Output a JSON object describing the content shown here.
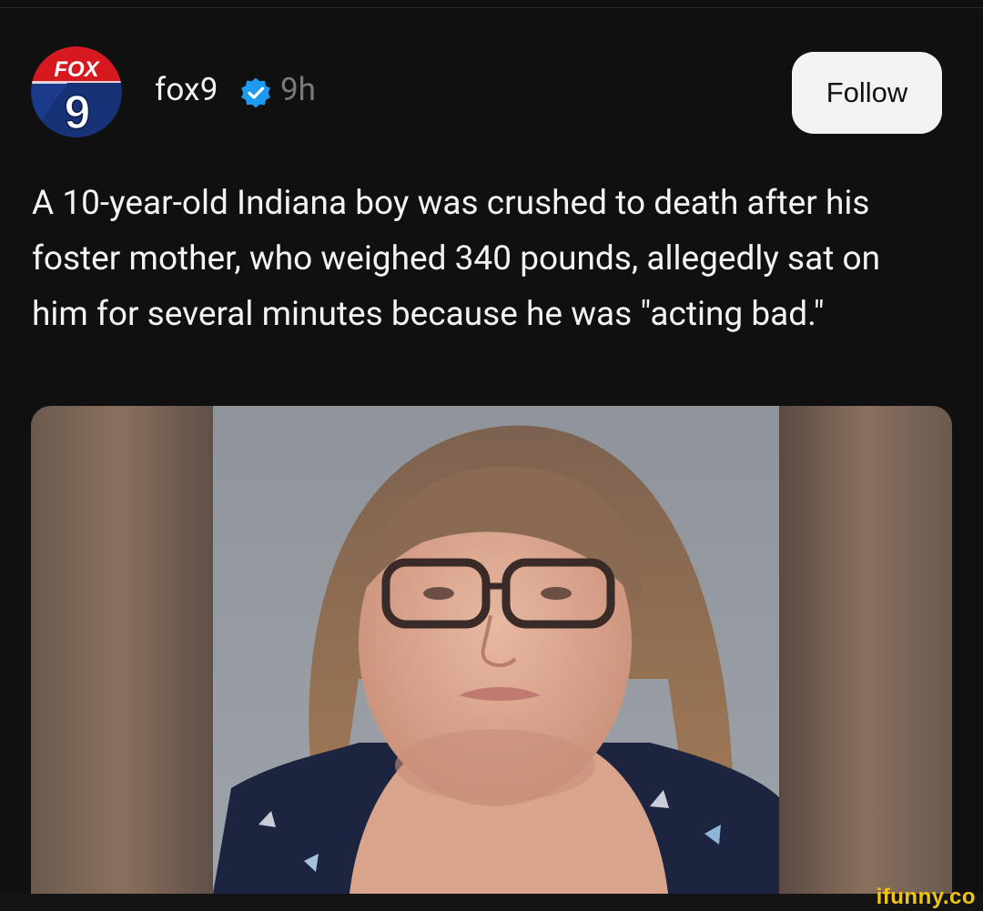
{
  "post": {
    "username": "fox9",
    "time": "9h",
    "follow_label": "Follow",
    "body": "A 10-year-old Indiana boy was crushed to death after his foster mother, who weighed 340 pounds, allegedly sat on him for several minutes because he was \"acting bad.\"",
    "avatar": {
      "label_top": "FOX",
      "label_number": "9"
    }
  },
  "watermark": "ifunny.co",
  "colors": {
    "background": "#101010",
    "follow_button": "#f2f3f5",
    "verified_badge": "#1d9bf0",
    "watermark": "#f1c40f"
  },
  "icons": {
    "verified": "verified-badge-icon",
    "avatar": "fox9-logo"
  }
}
